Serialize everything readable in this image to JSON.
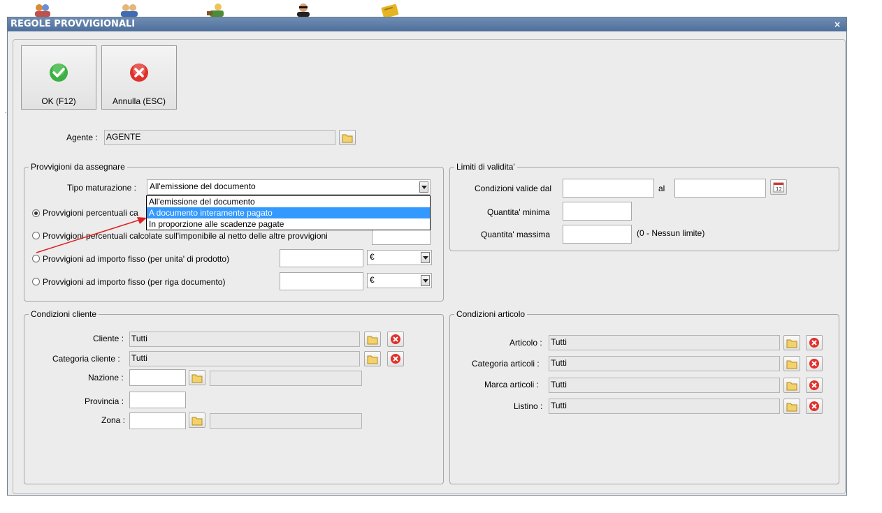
{
  "window": {
    "title": "REGOLE PROVVIGIONALI",
    "close_glyph": "×"
  },
  "toolbar": {
    "ok_label": "OK (F12)",
    "cancel_label": "Annulla (ESC)",
    "ok_color": "#3cb043",
    "cancel_color": "#e0312b"
  },
  "agent": {
    "label": "Agente :",
    "value": "AGENTE"
  },
  "provvigioni": {
    "legend": "Provvigioni da assegnare",
    "tipo_label": "Tipo maturazione :",
    "tipo_value": "All'emissione del documento",
    "radios": [
      {
        "label": "Provvigioni percentuali ca",
        "checked": true
      },
      {
        "label": "Provvigioni percentuali calcolate sull'imponibile al netto delle altre provvigioni",
        "checked": false
      },
      {
        "label": "Provvigioni ad importo fisso (per unita' di prodotto)",
        "checked": false
      },
      {
        "label": "Provvigioni ad importo fisso (per riga documento)",
        "checked": false
      }
    ],
    "currency_1": "€",
    "currency_2": "€",
    "dropdown_options": [
      {
        "label": "All'emissione del documento",
        "selected": false
      },
      {
        "label": "A documento interamente pagato",
        "selected": true
      },
      {
        "label": "In proporzione alle scadenze pagate",
        "selected": false
      }
    ]
  },
  "limiti": {
    "legend": "Limiti di validita'",
    "date_label": "Condizioni valide dal",
    "al_label": "al",
    "qmin_label": "Quantita' minima",
    "qmax_label": "Quantita' massima",
    "qmax_hint": "(0 - Nessun limite)"
  },
  "cliente": {
    "legend": "Condizioni cliente",
    "cliente_label": "Cliente :",
    "cliente_value": "Tutti",
    "categoria_label": "Categoria cliente :",
    "categoria_value": "Tutti",
    "nazione_label": "Nazione :",
    "provincia_label": "Provincia :",
    "zona_label": "Zona :"
  },
  "articolo": {
    "legend": "Condizioni articolo",
    "articolo_label": "Articolo :",
    "articolo_value": "Tutti",
    "categoria_label": "Categoria articoli :",
    "categoria_value": "Tutti",
    "marca_label": "Marca articoli :",
    "marca_value": "Tutti",
    "listino_label": "Listino :",
    "listino_value": "Tutti"
  },
  "colors": {
    "title_bar": "#5a7aa6",
    "selection": "#3399ff",
    "arrow": "#e02020"
  }
}
